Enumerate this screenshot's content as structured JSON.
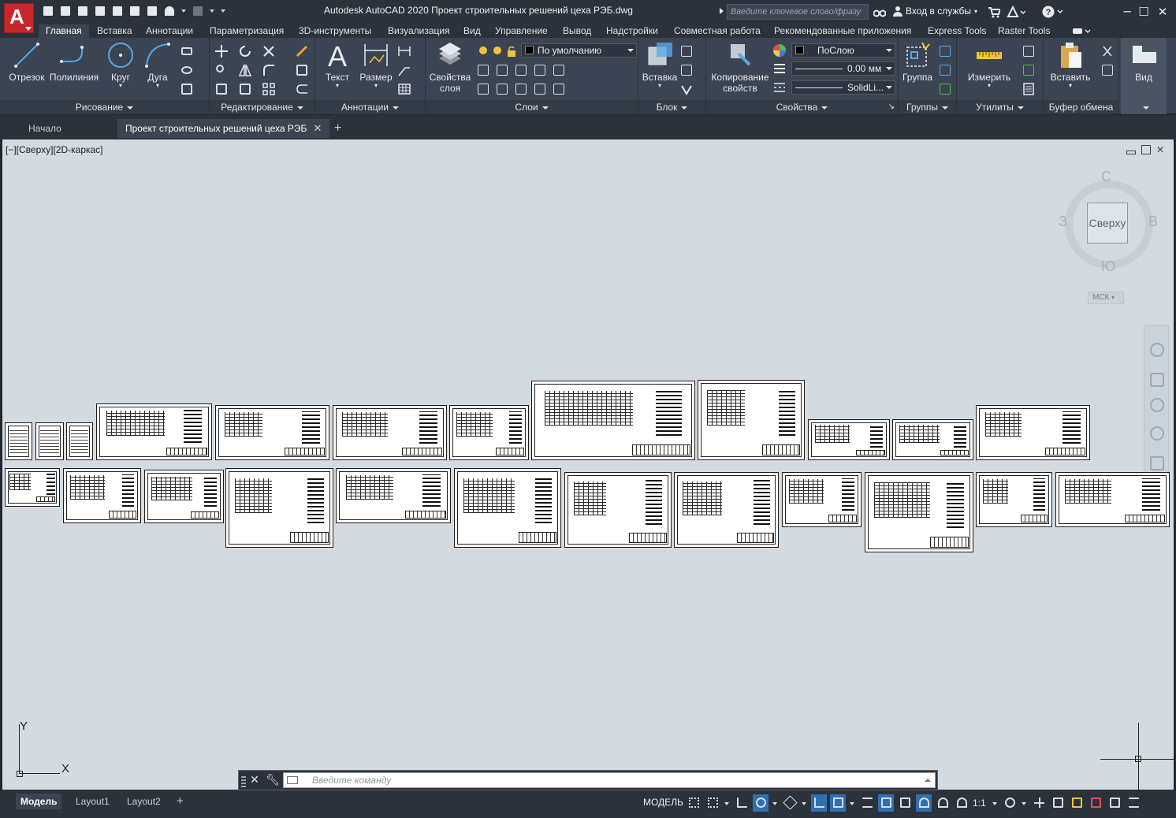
{
  "app": {
    "logo_letter": "A",
    "title": "Autodesk AutoCAD 2020    Проект строительных решений цеха РЭБ.dwg",
    "search_placeholder": "Введите ключевое слово/фразу",
    "signin_label": "Вход в службы",
    "help_label": "?"
  },
  "quick_access": [
    "new-icon",
    "open-icon",
    "save-icon",
    "save-as-icon",
    "publish-icon",
    "cloud-open-icon",
    "plot-icon",
    "undo-icon",
    "redo-icon",
    "customize-icon"
  ],
  "ribbon_tabs": [
    {
      "label": "Главная",
      "active": true
    },
    {
      "label": "Вставка"
    },
    {
      "label": "Аннотации"
    },
    {
      "label": "Параметризация"
    },
    {
      "label": "3D-инструменты"
    },
    {
      "label": "Визуализация"
    },
    {
      "label": "Вид"
    },
    {
      "label": "Управление"
    },
    {
      "label": "Вывод"
    },
    {
      "label": "Надстройки"
    },
    {
      "label": "Совместная работа"
    },
    {
      "label": "Рекомендованные приложения"
    },
    {
      "label": "Express Tools"
    },
    {
      "label": "Raster Tools"
    }
  ],
  "ribbon": {
    "draw": {
      "panel": "Рисование",
      "line": "Отрезок",
      "polyline": "Полилиния",
      "circle": "Круг",
      "arc": "Дуга"
    },
    "modify": {
      "panel": "Редактирование"
    },
    "annotation": {
      "panel": "Аннотации",
      "text": "Текст",
      "dimension": "Размер"
    },
    "layers": {
      "panel": "Слои",
      "props_line1": "Свойства",
      "props_line2": "слоя",
      "current_layer": "По умолчанию"
    },
    "block": {
      "panel": "Блок",
      "insert": "Вставка"
    },
    "properties": {
      "panel": "Свойства",
      "match_line1": "Копирование",
      "match_line2": "свойств",
      "color": "ПоСлою",
      "lineweight": "0.00 мм",
      "linetype": "SolidLi..."
    },
    "groups": {
      "panel": "Группы",
      "group": "Группа"
    },
    "utilities": {
      "panel": "Утилиты",
      "measure": "Измерить"
    },
    "clipboard": {
      "panel": "Буфер обмена",
      "paste": "Вставить"
    },
    "view": {
      "panel": "Вид"
    }
  },
  "file_tabs": [
    {
      "label": "Начало"
    },
    {
      "label": "Проект строительных решений цеха РЭБ",
      "active": true
    }
  ],
  "viewport": {
    "label": "[−][Сверху][2D-каркас]",
    "viewcube": {
      "face": "Сверху",
      "north": "С",
      "south": "Ю",
      "west": "З",
      "east": "В",
      "wcs": "МСК"
    },
    "ucs": {
      "x": "X",
      "y": "Y"
    }
  },
  "command_line": {
    "placeholder": "Введите команду"
  },
  "layout_tabs": [
    {
      "label": "Модель",
      "active": true
    },
    {
      "label": "Layout1"
    },
    {
      "label": "Layout2"
    }
  ],
  "status": {
    "space": "МОДЕЛЬ",
    "scale": "1:1"
  },
  "colors": {
    "background": "#212830",
    "canvas": "#d3dbe1",
    "ribbon": "#3b4452",
    "accent_logo": "#c8272b",
    "status_on": "#2f6fb3"
  }
}
